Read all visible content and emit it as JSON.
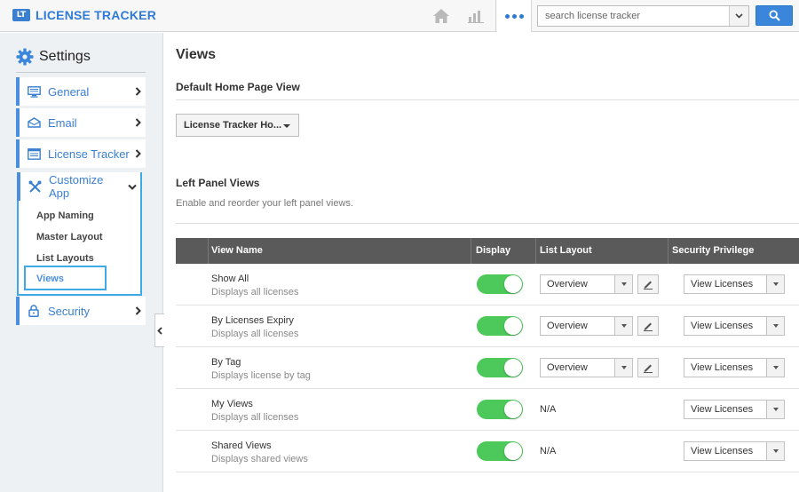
{
  "app": {
    "logo_badge": "LT",
    "title": "LICENSE TRACKER"
  },
  "topbar": {
    "search_placeholder": "search license tracker",
    "icons": [
      "home-icon",
      "bar-chart-icon",
      "more-dots-icon",
      "search-icon"
    ]
  },
  "sidebar": {
    "heading": "Settings",
    "items": [
      {
        "label": "General",
        "icon": "monitor-icon"
      },
      {
        "label": "Email",
        "icon": "envelope-icon"
      },
      {
        "label": "License Tracker",
        "icon": "list-window-icon"
      },
      {
        "label": "Customize App",
        "icon": "tools-icon"
      },
      {
        "label": "Security",
        "icon": "lock-icon"
      }
    ],
    "sub_items": [
      "App Naming",
      "Master Layout",
      "List Layouts",
      "Views"
    ],
    "active_sub": "Views"
  },
  "main": {
    "title": "Views",
    "default_section_title": "Default Home Page View",
    "default_dropdown": "License Tracker Ho...",
    "left_panel_title": "Left Panel Views",
    "left_panel_desc": "Enable and reorder your left panel views.",
    "columns": [
      "View Name",
      "Display",
      "List Layout",
      "Security Privilege"
    ],
    "rows": [
      {
        "name": "Show All",
        "desc": "Displays all licenses",
        "display": true,
        "list_layout": "Overview",
        "privilege": "View Licenses"
      },
      {
        "name": "By Licenses Expiry",
        "desc": "Displays all licenses",
        "display": true,
        "list_layout": "Overview",
        "privilege": "View Licenses"
      },
      {
        "name": "By Tag",
        "desc": "Displays license by tag",
        "display": true,
        "list_layout": "Overview",
        "privilege": "View Licenses"
      },
      {
        "name": "My Views",
        "desc": "Displays all licenses",
        "display": true,
        "list_layout": "N/A",
        "privilege": "View Licenses"
      },
      {
        "name": "Shared Views",
        "desc": "Displays shared views",
        "display": true,
        "list_layout": "N/A",
        "privilege": "View Licenses"
      }
    ]
  },
  "colors": {
    "accent": "#2f7ad6",
    "toggle_on": "#4cc95a",
    "highlight_border": "#3fa9e8",
    "table_header": "#5a5a5a"
  }
}
